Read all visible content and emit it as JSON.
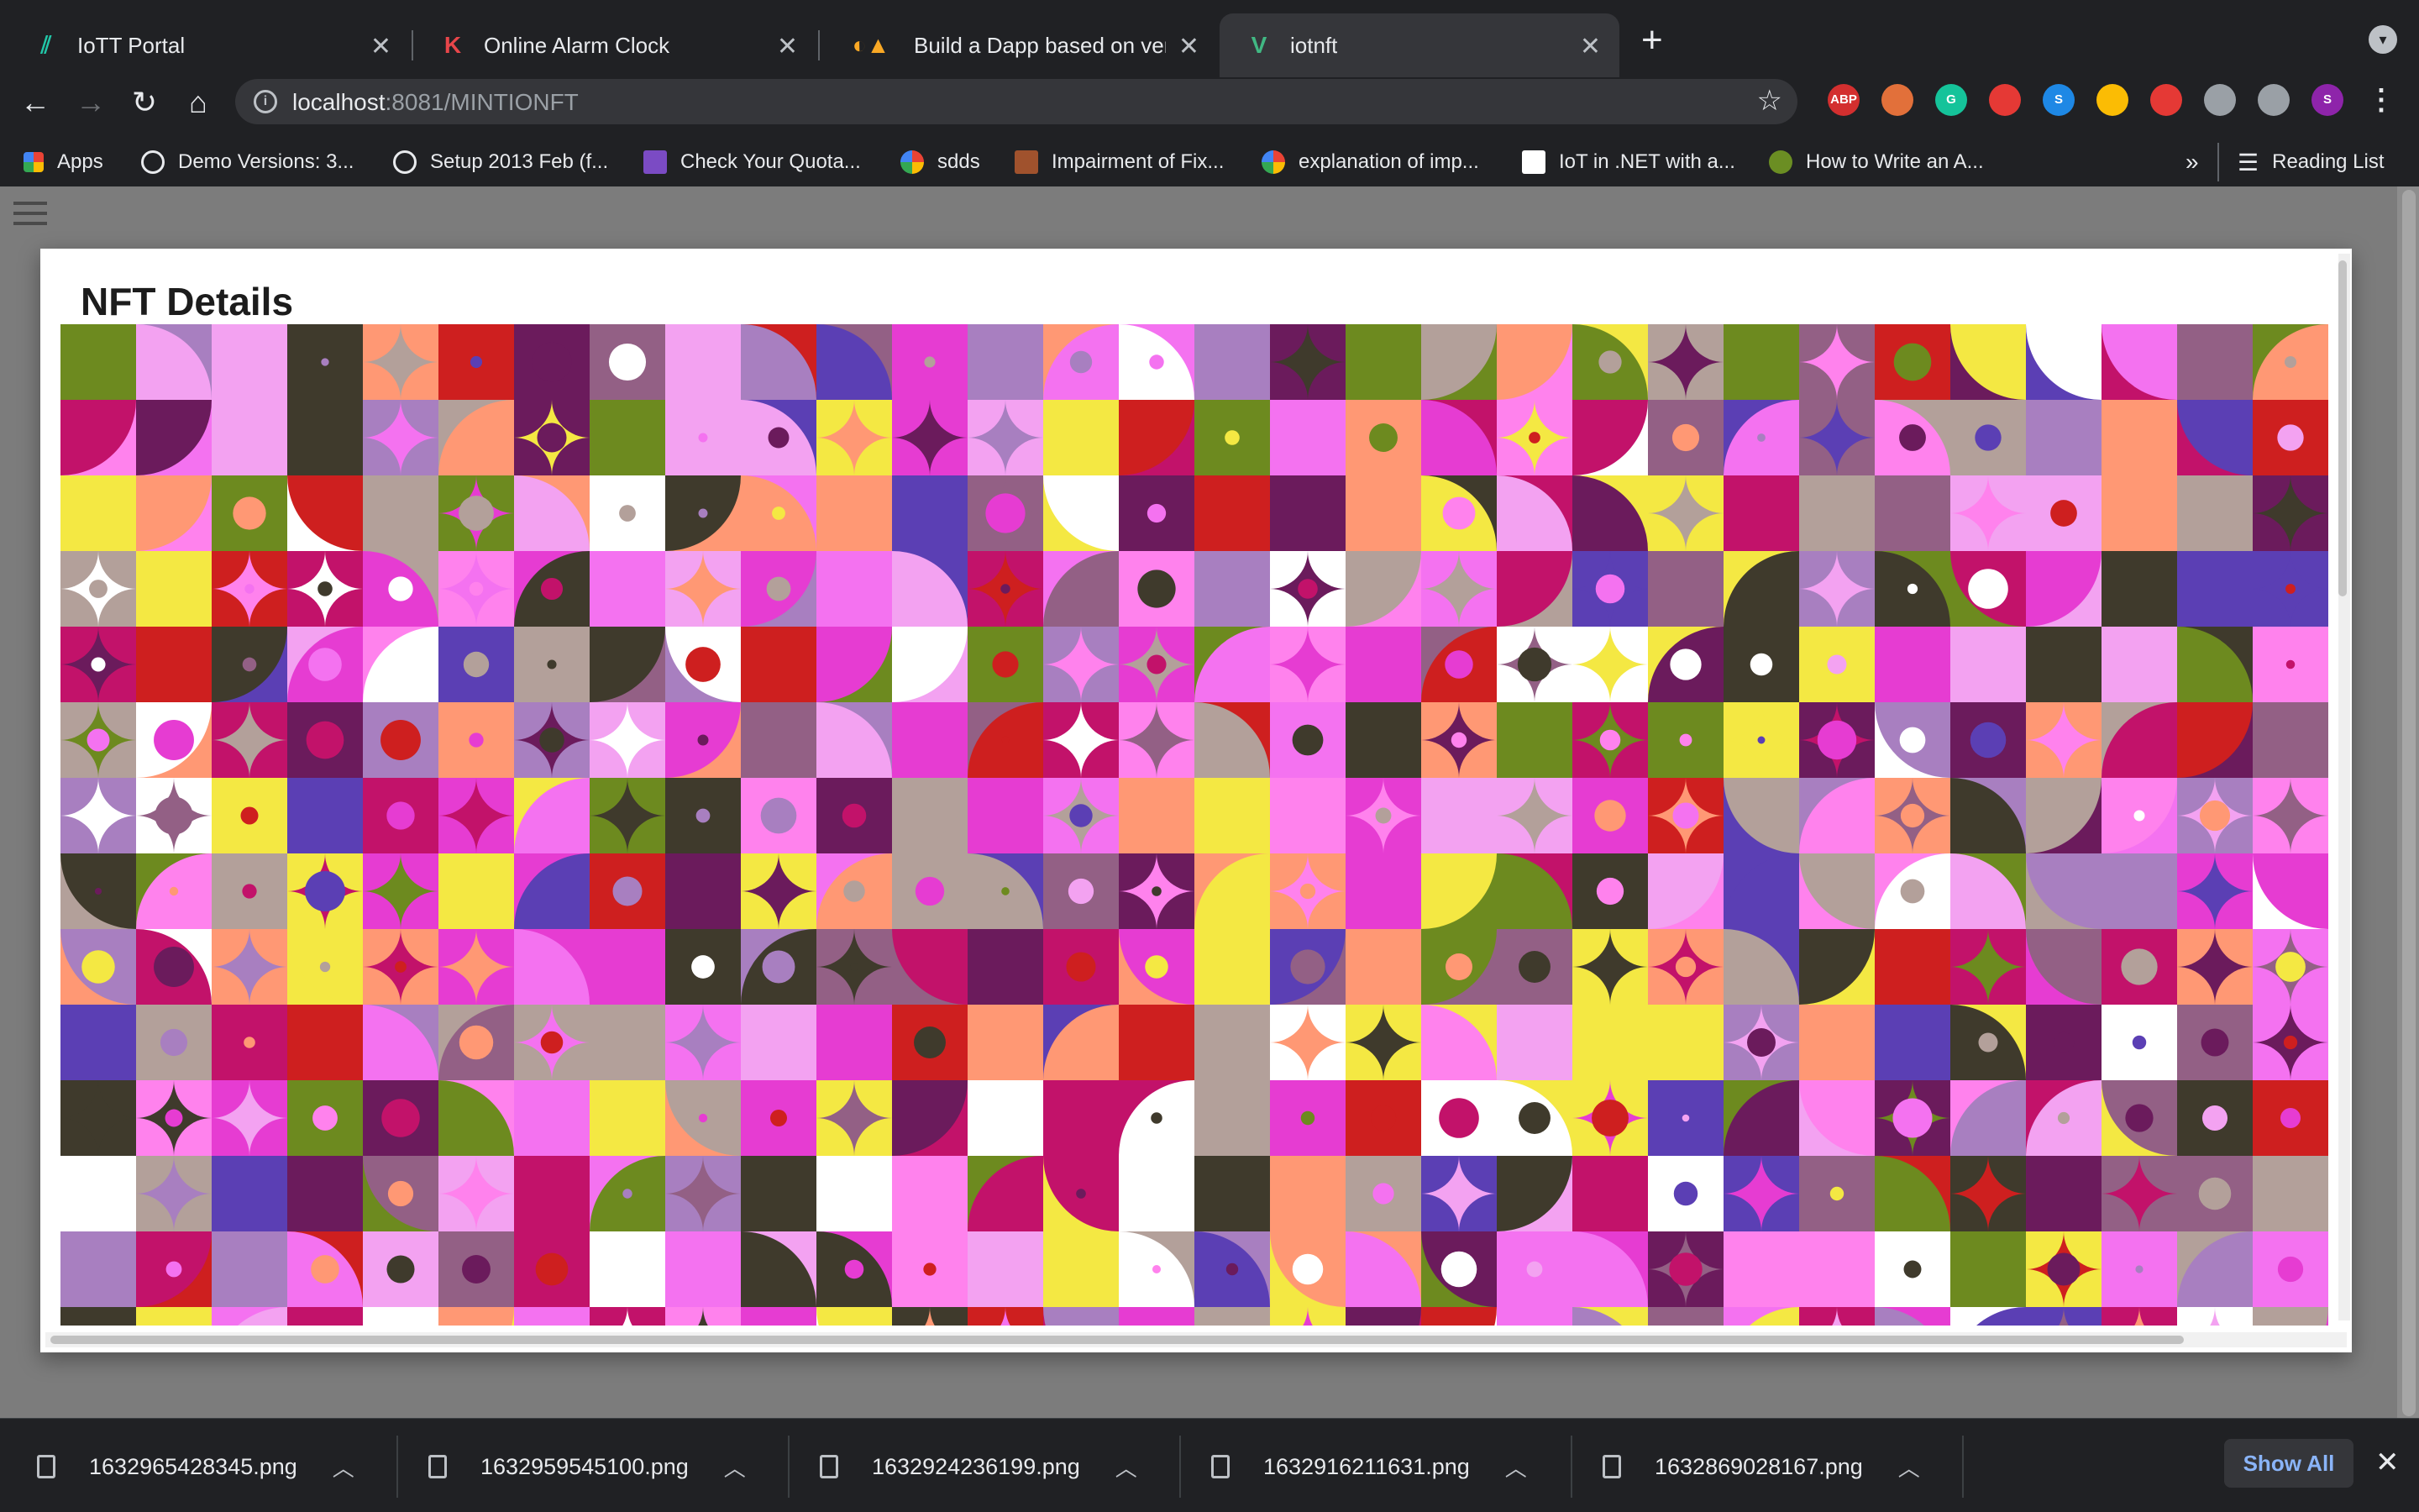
{
  "tabs": [
    {
      "title": "IoTT Portal",
      "icon": "iott-icon",
      "color": "#21c7a8"
    },
    {
      "title": "Online Alarm Clock",
      "icon": "k-icon",
      "color": "#e8464a"
    },
    {
      "title": "Build a Dapp based on verif",
      "icon": "fire-icon",
      "color": "#f9a825"
    },
    {
      "title": "iotnft",
      "icon": "vue-icon",
      "color": "#41b883"
    }
  ],
  "address": {
    "host": "localhost",
    "path": ":8081/MINTIONFT"
  },
  "extensions": [
    {
      "label": "ABP",
      "color": "#d32f2f"
    },
    {
      "label": "",
      "color": "#e2703a"
    },
    {
      "label": "G",
      "color": "#15c39a"
    },
    {
      "label": "",
      "color": "#e53935"
    },
    {
      "label": "S",
      "color": "#1e88e5"
    },
    {
      "label": "",
      "color": "#fbbc04"
    },
    {
      "label": "",
      "color": "#e53935"
    },
    {
      "label": "",
      "color": "#9aa0a6"
    },
    {
      "label": "",
      "color": "#9aa0a6"
    },
    {
      "label": "S",
      "color": "#8e24aa"
    }
  ],
  "bookmarks": [
    {
      "label": "Apps",
      "color": "#ea4335"
    },
    {
      "label": "Demo Versions: 3...",
      "color": "#e8eaed"
    },
    {
      "label": "Setup 2013 Feb (f...",
      "color": "#e8eaed"
    },
    {
      "label": "Check Your Quota...",
      "color": "#7b4bc4"
    },
    {
      "label": "sdds",
      "color": "#4285f4"
    },
    {
      "label": "Impairment of Fix...",
      "color": "#a0522d"
    },
    {
      "label": "explanation of imp...",
      "color": "#4285f4"
    },
    {
      "label": "IoT in .NET with a...",
      "color": "#000000"
    },
    {
      "label": "How to Write an A...",
      "color": "#6b8e23"
    }
  ],
  "reading_list": "Reading List",
  "more_bookmarks": "»",
  "dialog": {
    "title": "NFT Details"
  },
  "art_palette": [
    "#ff82ed",
    "#c2126a",
    "#ff9874",
    "#6b1b5c",
    "#5b3fb4",
    "#b3a09a",
    "#f472f0",
    "#6d8a1f",
    "#f4e843",
    "#ffffff",
    "#3f3a2c",
    "#ce1f1f",
    "#a87fc0",
    "#e63cd2",
    "#936085",
    "#f3a2f1"
  ],
  "downloads": [
    {
      "name": "1632965428345.png"
    },
    {
      "name": "1632959545100.png"
    },
    {
      "name": "1632924236199.png"
    },
    {
      "name": "1632916211631.png"
    },
    {
      "name": "1632869028167.png"
    }
  ],
  "show_all": "Show All"
}
